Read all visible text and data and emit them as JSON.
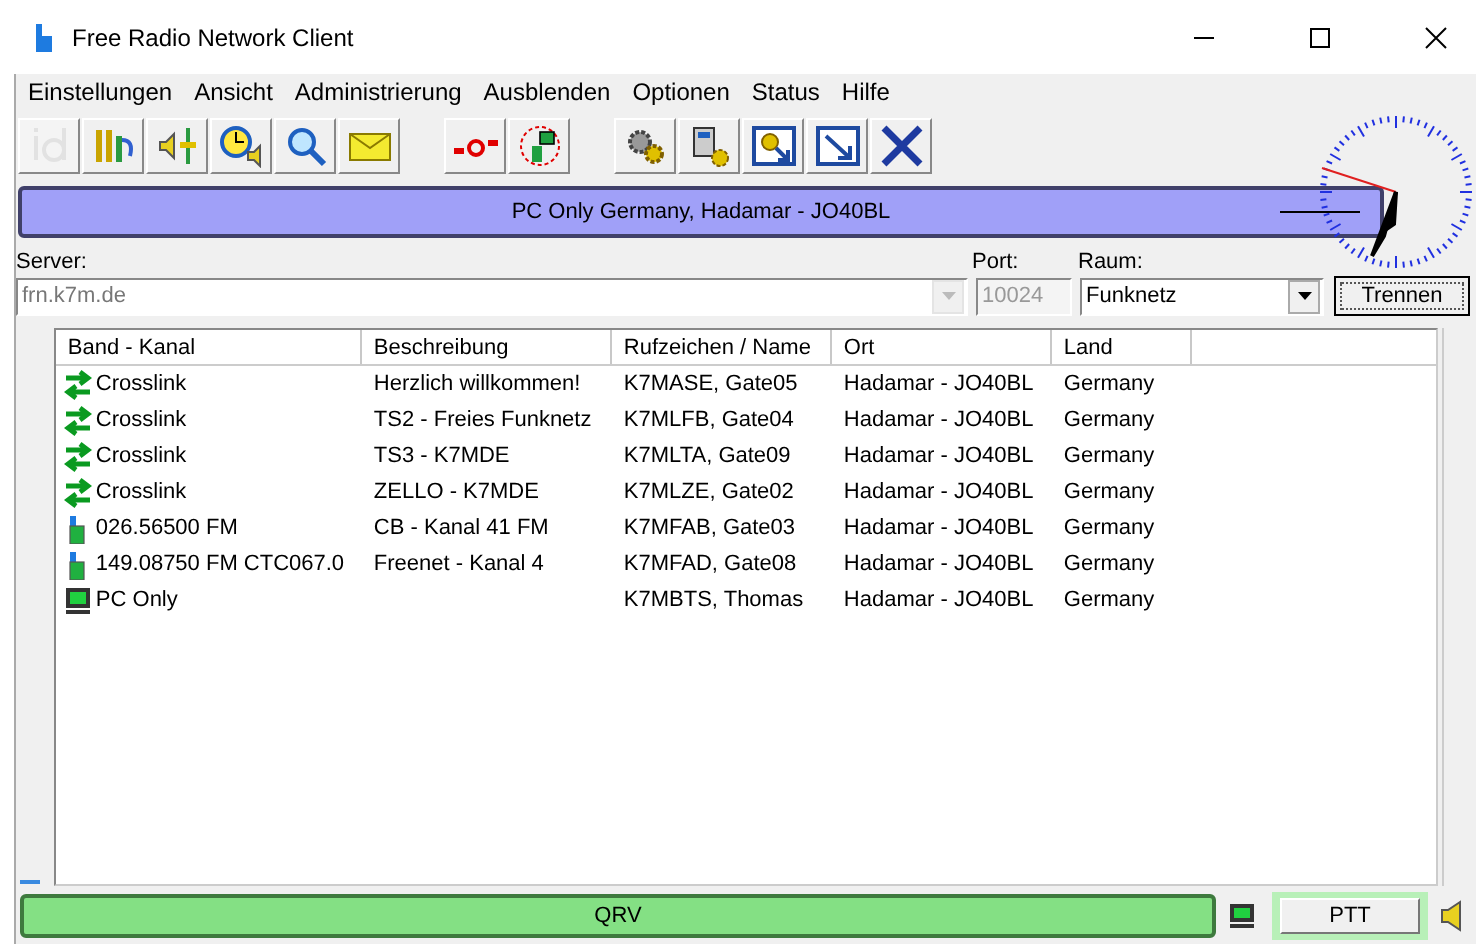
{
  "window": {
    "title": "Free Radio Network Client"
  },
  "menu": [
    "Einstellungen",
    "Ansicht",
    "Administrierung",
    "Ausblenden",
    "Optionen",
    "Status",
    "Hilfe"
  ],
  "toolbar": [
    [
      {
        "kind": "id",
        "disabled": true
      },
      {
        "kind": "cables",
        "disabled": false
      },
      {
        "kind": "volume",
        "disabled": false
      },
      {
        "kind": "timer",
        "disabled": false
      },
      {
        "kind": "search",
        "disabled": false
      },
      {
        "kind": "mail",
        "disabled": false
      }
    ],
    [
      {
        "kind": "link",
        "disabled": false
      },
      {
        "kind": "radio",
        "disabled": false
      }
    ],
    [
      {
        "kind": "gears",
        "disabled": false
      },
      {
        "kind": "device",
        "disabled": false
      },
      {
        "kind": "gearwin",
        "disabled": false
      },
      {
        "kind": "arrowwin",
        "disabled": false
      },
      {
        "kind": "close",
        "disabled": false
      }
    ]
  ],
  "banner": {
    "text": "PC Only Germany, Hadamar - JO40BL"
  },
  "connection": {
    "server": {
      "label": "Server:",
      "value": "frn.k7m.de"
    },
    "port": {
      "label": "Port:",
      "value": "10024",
      "disabled": true
    },
    "room": {
      "label": "Raum:",
      "value": "Funknetz"
    },
    "button": "Trennen"
  },
  "table": {
    "columns": [
      "Band - Kanal",
      "Beschreibung",
      "Rufzeichen / Name",
      "Ort",
      "Land"
    ],
    "rows": [
      {
        "kind": "crosslink",
        "cells": [
          "Crosslink",
          "Herzlich willkommen!",
          "K7MASE, Gate05",
          "Hadamar - JO40BL",
          "Germany"
        ]
      },
      {
        "kind": "crosslink",
        "cells": [
          "Crosslink",
          "TS2 - Freies Funknetz",
          "K7MLFB, Gate04",
          "Hadamar - JO40BL",
          "Germany"
        ]
      },
      {
        "kind": "crosslink",
        "cells": [
          "Crosslink",
          "TS3 - K7MDE",
          "K7MLTA, Gate09",
          "Hadamar - JO40BL",
          "Germany"
        ]
      },
      {
        "kind": "crosslink",
        "cells": [
          "Crosslink",
          "ZELLO - K7MDE",
          "K7MLZE, Gate02",
          "Hadamar - JO40BL",
          "Germany"
        ]
      },
      {
        "kind": "radio",
        "cells": [
          "026.56500 FM",
          "CB - Kanal 41 FM",
          "K7MFAB, Gate03",
          "Hadamar - JO40BL",
          "Germany"
        ]
      },
      {
        "kind": "radio",
        "cells": [
          "149.08750 FM CTC067.0",
          "Freenet - Kanal 4",
          "K7MFAD, Gate08",
          "Hadamar - JO40BL",
          "Germany"
        ]
      },
      {
        "kind": "pc",
        "cells": [
          "PC Only",
          "",
          "K7MBTS, Thomas",
          "Hadamar - JO40BL",
          "Germany"
        ]
      }
    ]
  },
  "status_bar": {
    "status": "QRV",
    "ptt": "PTT"
  }
}
